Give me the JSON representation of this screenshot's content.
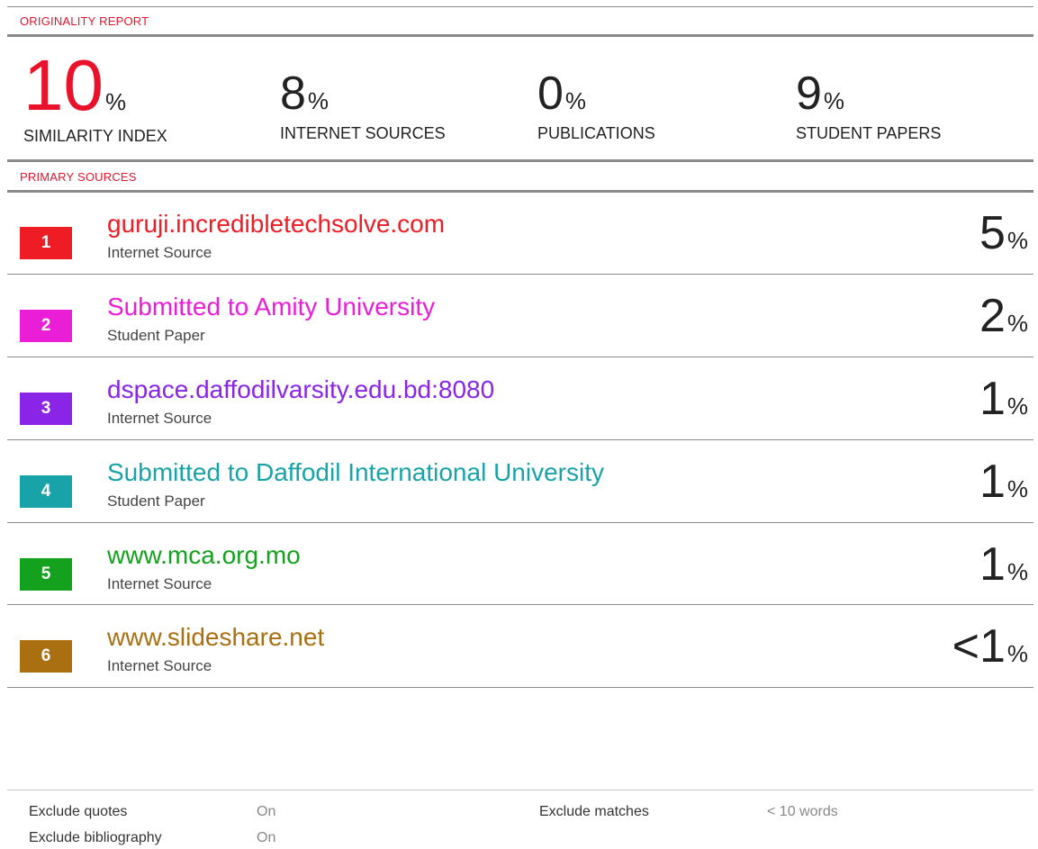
{
  "report": {
    "heading": "ORIGINALITY REPORT",
    "stats": [
      {
        "value": "10",
        "unit": "%",
        "label": "SIMILARITY INDEX"
      },
      {
        "value": "8",
        "unit": "%",
        "label": "INTERNET SOURCES"
      },
      {
        "value": "0",
        "unit": "%",
        "label": "PUBLICATIONS"
      },
      {
        "value": "9",
        "unit": "%",
        "label": "STUDENT PAPERS"
      }
    ],
    "primary_heading": "PRIMARY SOURCES",
    "sources": [
      {
        "rank": "1",
        "title": "guruji.incredibletechsolve.com",
        "type": "Internet Source",
        "percent": "5",
        "unit": "%",
        "color": "#ee1c25"
      },
      {
        "rank": "2",
        "title": "Submitted to Amity University",
        "type": "Student Paper",
        "percent": "2",
        "unit": "%",
        "color": "#e91ed6"
      },
      {
        "rank": "3",
        "title": "dspace.daffodilvarsity.edu.bd:8080",
        "type": "Internet Source",
        "percent": "1",
        "unit": "%",
        "color": "#8a25e8"
      },
      {
        "rank": "4",
        "title": "Submitted to Daffodil International University",
        "type": "Student Paper",
        "percent": "1",
        "unit": "%",
        "color": "#18a3a8"
      },
      {
        "rank": "5",
        "title": "www.mca.org.mo",
        "type": "Internet Source",
        "percent": "1",
        "unit": "%",
        "color": "#14a21e"
      },
      {
        "rank": "6",
        "title": "www.slideshare.net",
        "type": "Internet Source",
        "percent": "<1",
        "unit": "%",
        "color": "#a96f10"
      }
    ]
  },
  "footer": {
    "exclude_quotes_label": "Exclude quotes",
    "exclude_quotes_value": "On",
    "exclude_bibliography_label": "Exclude bibliography",
    "exclude_bibliography_value": "On",
    "exclude_matches_label": "Exclude matches",
    "exclude_matches_value": "< 10 words"
  },
  "colors": {
    "accent": "#e8132b",
    "rule": "#8a8a8a"
  }
}
